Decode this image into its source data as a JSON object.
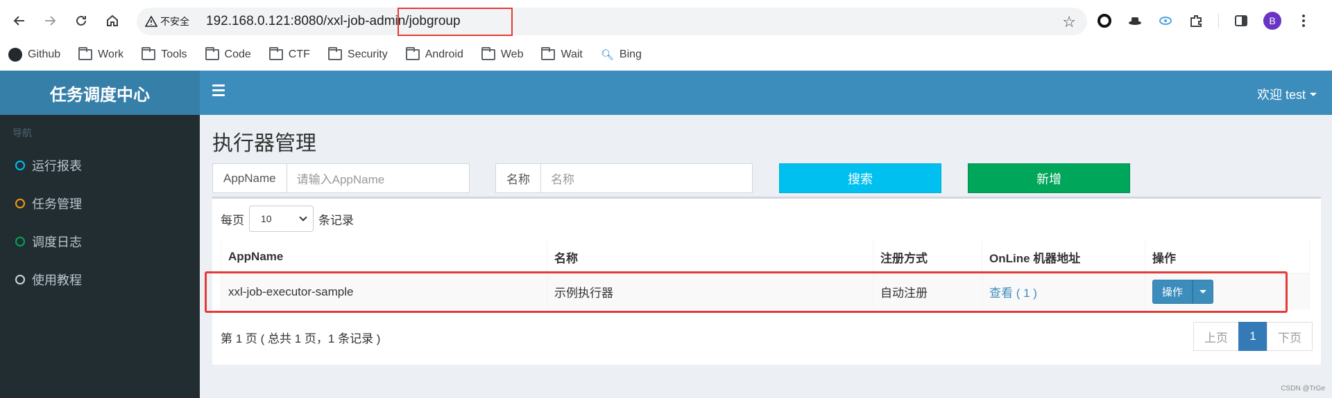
{
  "browser": {
    "security_label": "不安全",
    "url": "192.168.0.121:8080/xxl-job-admin/jobgroup",
    "profile_initial": "B",
    "bookmarks": [
      "Github",
      "Work",
      "Tools",
      "Code",
      "CTF",
      "Security",
      "Android",
      "Web",
      "Wait",
      "Bing"
    ]
  },
  "app": {
    "logo": "任务调度中心",
    "welcome": "欢迎 test",
    "nav_header": "导航",
    "nav_items": [
      {
        "label": "运行报表",
        "color": "#00c0ef"
      },
      {
        "label": "任务管理",
        "color": "#f39c12"
      },
      {
        "label": "调度日志",
        "color": "#00a65a"
      },
      {
        "label": "使用教程",
        "color": "#d2d6de"
      }
    ],
    "page_title": "执行器管理"
  },
  "filters": {
    "appname_label": "AppName",
    "appname_placeholder": "请输入AppName",
    "title_label": "名称",
    "title_placeholder": "名称",
    "search_button": "搜索",
    "add_button": "新增"
  },
  "table": {
    "per_page_prefix": "每页",
    "per_page_value": "10",
    "per_page_suffix": "条记录",
    "columns": [
      "AppName",
      "名称",
      "注册方式",
      "OnLine 机器地址",
      "操作"
    ],
    "rows": [
      {
        "appname": "xxl-job-executor-sample",
        "title": "示例执行器",
        "register_type": "自动注册",
        "online": "查看 ( 1 )",
        "action": "操作"
      }
    ],
    "info": "第 1 页 ( 总共 1 页，1 条记录 )",
    "pagination": {
      "prev": "上页",
      "current": "1",
      "next": "下页"
    }
  },
  "watermark": "CSDN @TrGe"
}
